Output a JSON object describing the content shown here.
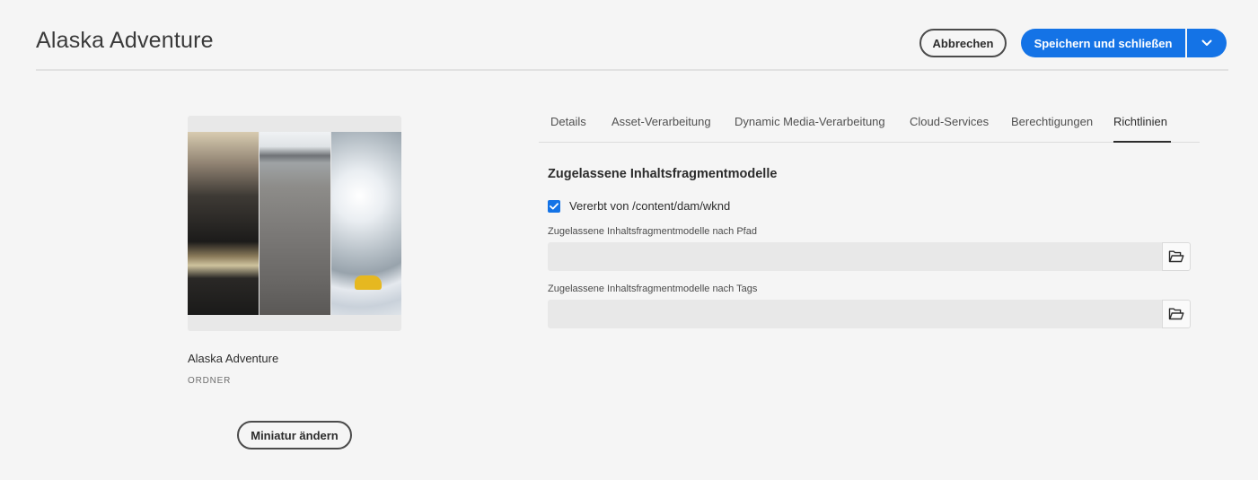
{
  "header": {
    "title": "Alaska Adventure",
    "cancel_label": "Abbrechen",
    "save_label": "Speichern und schließen"
  },
  "preview": {
    "name": "Alaska Adventure",
    "type": "ORDNER",
    "change_thumbnail_label": "Miniatur ändern"
  },
  "tabs": [
    {
      "label": "Details"
    },
    {
      "label": "Asset-Verarbeitung"
    },
    {
      "label": "Dynamic Media-Verarbeitung"
    },
    {
      "label": "Cloud-Services"
    },
    {
      "label": "Berechtigungen"
    },
    {
      "label": "Richtlinien",
      "selected": true
    }
  ],
  "policies": {
    "section_title": "Zugelassene Inhaltsfragmentmodelle",
    "inherit_checked": true,
    "inherit_label": "Vererbt von /content/dam/wknd",
    "path_field_label": "Zugelassene Inhaltsfragmentmodelle nach Pfad",
    "path_field_value": "",
    "tags_field_label": "Zugelassene Inhaltsfragmentmodelle nach Tags",
    "tags_field_value": ""
  },
  "icons": {
    "dropdown": "chevron-down-icon",
    "browse": "folder-open-icon",
    "check": "checkmark-icon"
  },
  "colors": {
    "accent": "#1473e6",
    "background": "#f5f5f5",
    "field": "#e8e8e8"
  }
}
